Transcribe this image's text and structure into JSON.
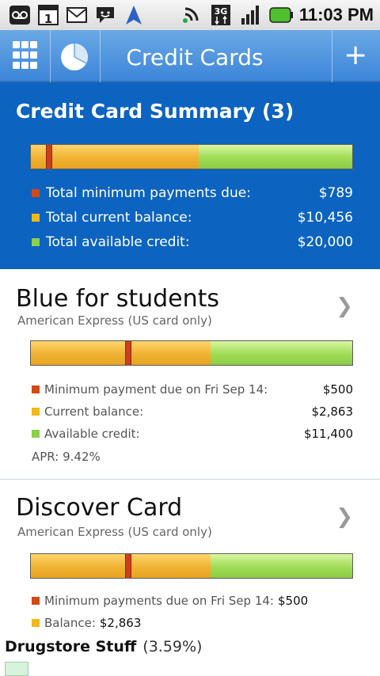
{
  "status_bar": {
    "time": "11:03 PM",
    "calendar_day": "1",
    "network": "3G",
    "icons": [
      "voicemail-icon",
      "calendar-icon",
      "gmail-icon",
      "chat-icon",
      "navigation-icon",
      "sync-icon",
      "network-3g-icon",
      "signal-icon",
      "battery-icon"
    ]
  },
  "app_bar": {
    "title": "Credit Cards"
  },
  "summary": {
    "title": "Credit Card Summary (3)",
    "bar": {
      "used_fraction": 0.523,
      "marker_fraction": 0.055
    },
    "rows": [
      {
        "label": "Total minimum payments due:",
        "value": "$789"
      },
      {
        "label": "Total current balance:",
        "value": "$10,456"
      },
      {
        "label": "Total available credit:",
        "value": "$20,000"
      }
    ]
  },
  "cards": [
    {
      "name": "Blue for students",
      "issuer": "American Express (US card only)",
      "bar": {
        "used_fraction": 0.56,
        "marker_fraction": 0.3
      },
      "rows": [
        {
          "label": "Minimum payment due on Fri Sep 14:",
          "value": "$500"
        },
        {
          "label": "Current balance:",
          "value": "$2,863"
        },
        {
          "label": "Available credit:",
          "value": "$11,400"
        }
      ],
      "apr": "APR: 9.42%"
    },
    {
      "name": "Discover Card",
      "issuer": "American Express (US card only)",
      "bar": {
        "used_fraction": 0.56,
        "marker_fraction": 0.3
      },
      "rows": [
        {
          "label": "Minimum payments due on Fri Sep 14:",
          "value": "$500"
        },
        {
          "label": "Balance:",
          "value": "$2,863"
        }
      ]
    }
  ],
  "drugstore": {
    "name": "Drugstore Stuff",
    "pct": "(3.59%)"
  },
  "colors": {
    "brand": "#0c63c0",
    "minimum": "#d04a17",
    "balance": "#f2b81b",
    "available": "#8dd14b"
  }
}
